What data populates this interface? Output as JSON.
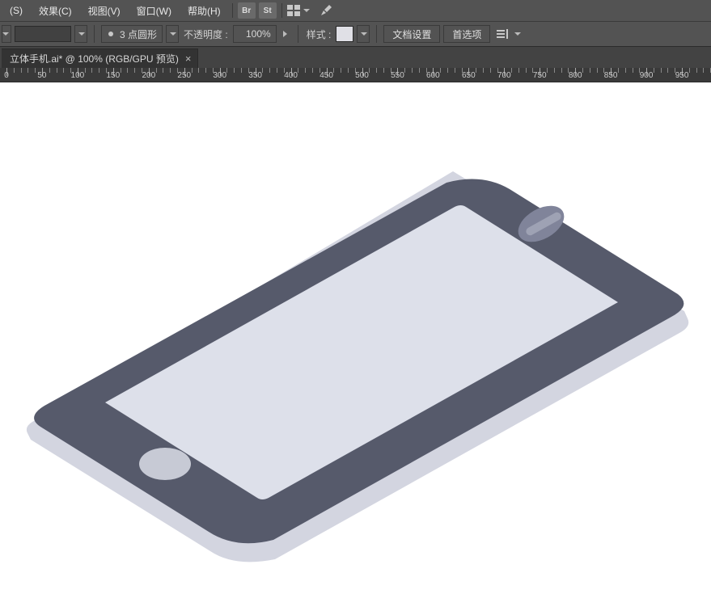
{
  "menus": {
    "s": "(S)",
    "effect": "效果(C)",
    "view": "视图(V)",
    "window": "窗口(W)",
    "help": "帮助(H)"
  },
  "menubar_icons": {
    "br": "Br",
    "st": "St"
  },
  "options": {
    "stroke_profile": "3 点圆形",
    "opacity_label": "不透明度 :",
    "opacity_value": "100%",
    "style_label": "样式 :",
    "doc_setup": "文档设置",
    "preferences": "首选项"
  },
  "tab": {
    "title": "立体手机.ai* @ 100% (RGB/GPU 预览)"
  },
  "ruler": {
    "start": 0,
    "end": 960,
    "step": 50
  },
  "colors": {
    "phone_body": "#565a6b",
    "phone_screen": "#dde0ea",
    "phone_shadow": "#d3d5e0",
    "phone_button": "#c7cad5"
  }
}
